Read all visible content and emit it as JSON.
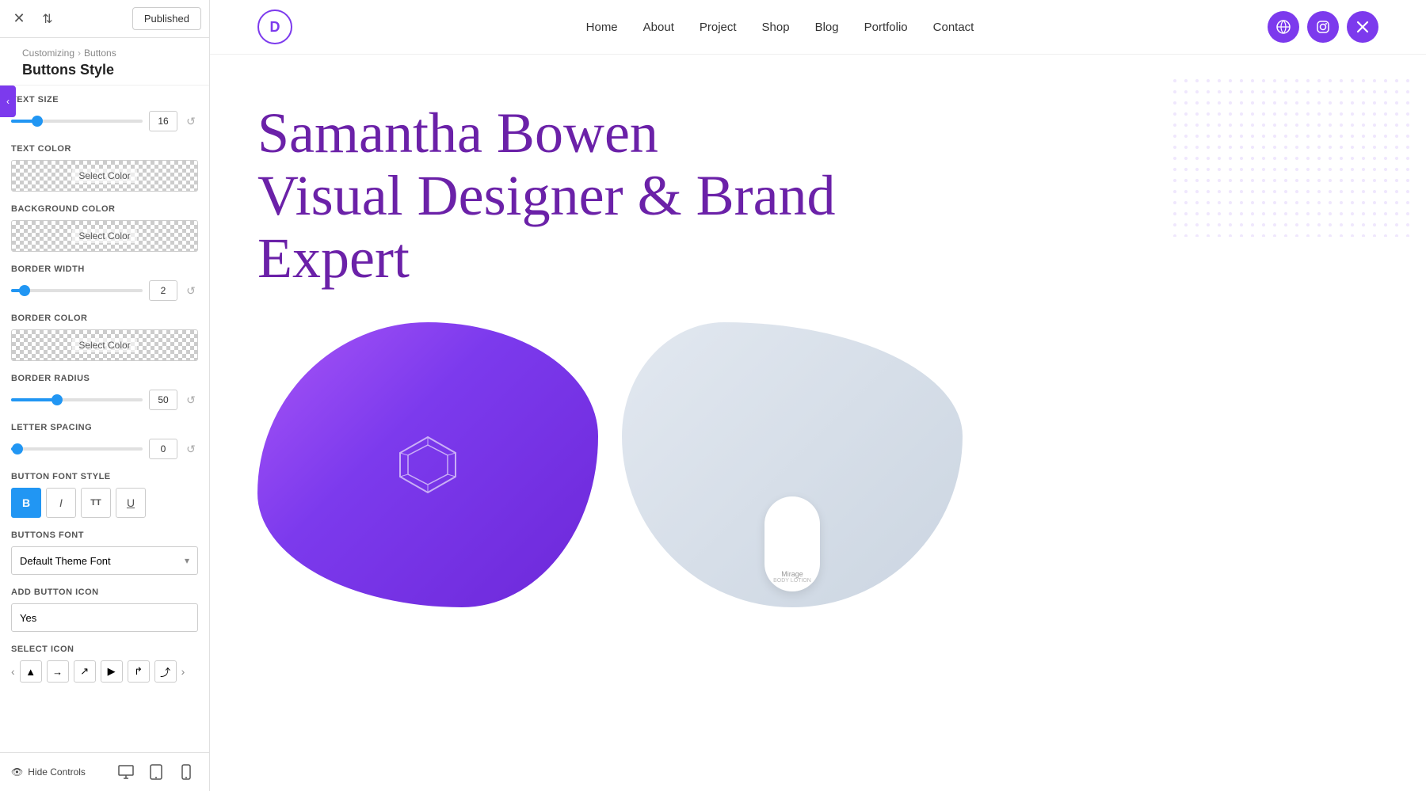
{
  "topbar": {
    "published_label": "Published",
    "close_icon": "✕",
    "swap_icon": "⇅"
  },
  "breadcrumb": {
    "parent": "Customizing",
    "separator": "›",
    "current": "Buttons",
    "title": "Buttons Style"
  },
  "controls": {
    "text_size": {
      "label": "TEXT SIZE",
      "value": "16",
      "slider_pct": 20
    },
    "text_color": {
      "label": "TEXT COLOR",
      "select_label": "Select Color"
    },
    "bg_color": {
      "label": "BACKGROUND COLOR",
      "select_label": "Select Color"
    },
    "border_width": {
      "label": "BORDER WIDTH",
      "value": "2",
      "slider_pct": 10
    },
    "border_color": {
      "label": "BORDER COLOR",
      "select_label": "Select Color"
    },
    "border_radius": {
      "label": "BORDER RADIUS",
      "value": "50",
      "slider_pct": 35
    },
    "letter_spacing": {
      "label": "LETTER SPACING",
      "value": "0",
      "slider_pct": 5
    },
    "font_style": {
      "label": "BUTTON FONT STYLE",
      "buttons": [
        "B",
        "I",
        "TT",
        "U"
      ],
      "active": 0
    },
    "buttons_font": {
      "label": "BUTTONS FONT",
      "value": "Default Theme Font"
    },
    "add_icon": {
      "label": "ADD BUTTON ICON",
      "value": "Yes"
    },
    "select_icon": {
      "label": "SELECT ICON"
    }
  },
  "bottom_toolbar": {
    "hide_label": "Hide Controls",
    "eye_icon": "👁",
    "desktop_icon": "🖥",
    "tablet_icon": "📱",
    "mobile_icon": "📱"
  },
  "preview": {
    "logo_letter": "D",
    "nav_links": [
      "Home",
      "About",
      "Project",
      "Shop",
      "Blog",
      "Portfolio",
      "Contact"
    ],
    "hero_line1": "Samantha Bowen",
    "hero_line2": "Visual Designer & Brand",
    "hero_line3": "Expert",
    "social_icons": [
      "🌐",
      "📷",
      "✕"
    ]
  }
}
